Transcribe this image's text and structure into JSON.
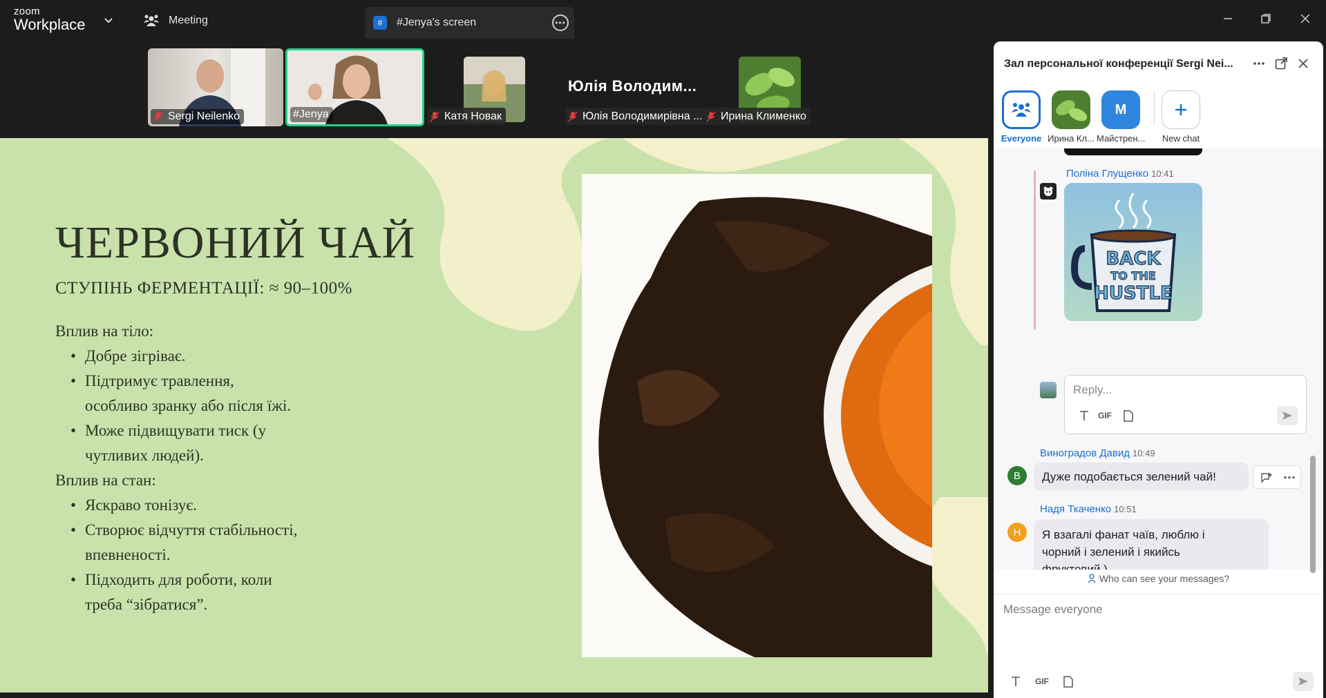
{
  "app": {
    "logo_line1": "zoom",
    "logo_line2": "Workplace"
  },
  "tabs": {
    "meeting": "Meeting",
    "screen": "#Jenya's screen",
    "screen_icon": "#"
  },
  "participants": [
    {
      "name": "Sergi Neilenko",
      "muted": true
    },
    {
      "name": "#Jenya",
      "muted": false
    },
    {
      "name": "Катя Новак",
      "muted": true
    },
    {
      "name": "Юлія Володимирівна ...",
      "muted": true,
      "display_name": "Юлія Володим..."
    },
    {
      "name": "Ирина Клименко",
      "muted": true
    }
  ],
  "slide": {
    "title": "ЧЕРВОНИЙ ЧАЙ",
    "subtitle": "СТУПІНЬ ФЕРМЕНТАЦІЇ: ≈ 90–100%",
    "lines": [
      {
        "text": "Вплив на тіло:",
        "bullet": false,
        "indent": false
      },
      {
        "text": "Добре зігріває.",
        "bullet": true,
        "indent": true
      },
      {
        "text": "Підтримує травлення,",
        "bullet": true,
        "indent": true
      },
      {
        "text": "особливо зранку або після їжі.",
        "bullet": false,
        "indent": true
      },
      {
        "text": "Може підвищувати тиск (у",
        "bullet": true,
        "indent": true
      },
      {
        "text": "чутливих людей).",
        "bullet": false,
        "indent": true
      },
      {
        "text": "Вплив на стан:",
        "bullet": false,
        "indent": false
      },
      {
        "text": "Яскраво тонізує.",
        "bullet": true,
        "indent": true
      },
      {
        "text": "Створює відчуття стабільності,",
        "bullet": true,
        "indent": true
      },
      {
        "text": "впевненості.",
        "bullet": false,
        "indent": true
      },
      {
        "text": "Підходить для роботи, коли",
        "bullet": true,
        "indent": true
      },
      {
        "text": "треба “зібратися”.",
        "bullet": false,
        "indent": true
      }
    ]
  },
  "chat": {
    "title": "Зал персональної конференції Sergi Nei...",
    "targets": [
      {
        "label": "Everyone",
        "icon": "group-icon"
      },
      {
        "label": "Ирина Кл...",
        "icon": "leaf-avatar"
      },
      {
        "label": "Майстрен...",
        "initial": "M"
      },
      {
        "label": "New chat",
        "icon": "plus-icon"
      }
    ],
    "thread": {
      "sender": "Поліна Глущенко",
      "time": "10:41",
      "sticker_lines": [
        "BACK",
        "TO THE",
        "HUSTLE"
      ],
      "reply_placeholder": "Reply..."
    },
    "messages": [
      {
        "sender": "Виноградов Давид",
        "time": "10:49",
        "initial": "В",
        "color": "#2e7d32",
        "text": "Дуже подобається зелений чай!"
      },
      {
        "sender": "Надя Ткаченко",
        "time": "10:51",
        "initial": "Н",
        "color": "#f0a020",
        "text_lines": [
          "Я взагалі фанат чаїв, люблю і",
          "чорний і зелений і якийсь",
          "фруктовий )"
        ]
      }
    ],
    "who_can_see": "Who can see your messages?",
    "compose_placeholder": "Message everyone",
    "gif_label": "GIF"
  }
}
